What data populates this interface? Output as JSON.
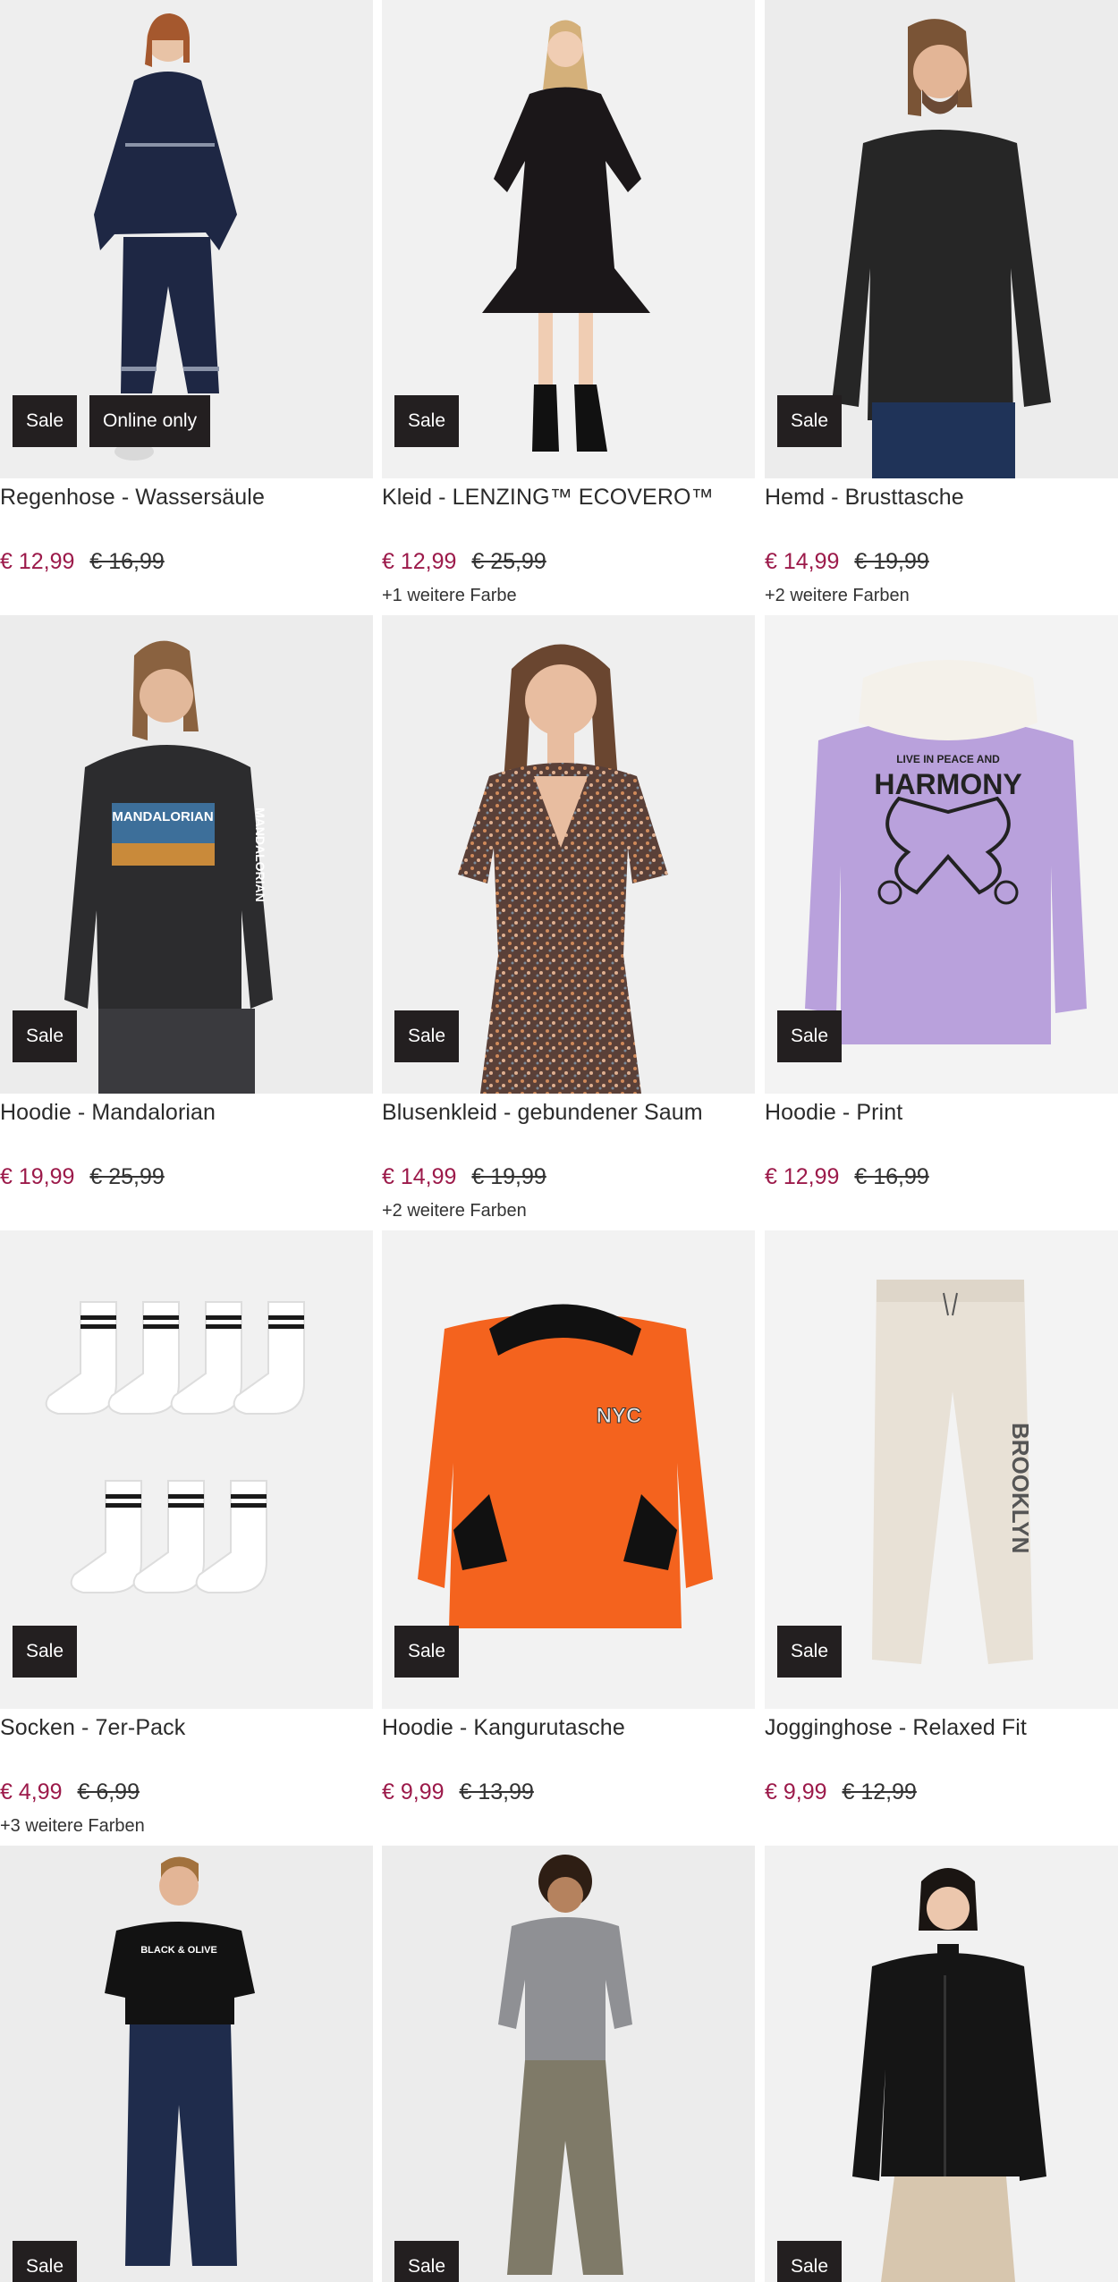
{
  "products": [
    {
      "title": "Regenhose - Wassersäule",
      "price": "€ 12,99",
      "old_price": "€ 16,99",
      "badges": [
        "Sale",
        "Online only"
      ],
      "colors_note": ""
    },
    {
      "title": "Kleid - LENZING™ ECOVERO™",
      "price": "€ 12,99",
      "old_price": "€ 25,99",
      "badges": [
        "Sale"
      ],
      "colors_note": "+1 weitere Farbe"
    },
    {
      "title": "Hemd - Brusttasche",
      "price": "€ 14,99",
      "old_price": "€ 19,99",
      "badges": [
        "Sale"
      ],
      "colors_note": "+2 weitere Farben"
    },
    {
      "title": "Hoodie - Mandalorian",
      "price": "€ 19,99",
      "old_price": "€ 25,99",
      "badges": [
        "Sale"
      ],
      "colors_note": ""
    },
    {
      "title": "Blusenkleid - gebundener Saum",
      "price": "€ 14,99",
      "old_price": "€ 19,99",
      "badges": [
        "Sale"
      ],
      "colors_note": "+2 weitere Farben"
    },
    {
      "title": "Hoodie - Print",
      "price": "€ 12,99",
      "old_price": "€ 16,99",
      "badges": [
        "Sale"
      ],
      "colors_note": ""
    },
    {
      "title": "Socken - 7er-Pack",
      "price": "€ 4,99",
      "old_price": "€ 6,99",
      "badges": [
        "Sale"
      ],
      "colors_note": "+3 weitere Farben"
    },
    {
      "title": "Hoodie - Kangurutasche",
      "price": "€ 9,99",
      "old_price": "€ 13,99",
      "badges": [
        "Sale"
      ],
      "colors_note": ""
    },
    {
      "title": "Jogginghose - Relaxed Fit",
      "price": "€ 9,99",
      "old_price": "€ 12,99",
      "badges": [
        "Sale"
      ],
      "colors_note": ""
    },
    {
      "title": "",
      "price": "",
      "old_price": "",
      "badges": [
        "Sale"
      ],
      "colors_note": ""
    },
    {
      "title": "",
      "price": "",
      "old_price": "",
      "badges": [
        "Sale"
      ],
      "colors_note": ""
    },
    {
      "title": "",
      "price": "",
      "old_price": "",
      "badges": [
        "Sale"
      ],
      "colors_note": ""
    }
  ],
  "print_text": {
    "mandalorian_front": "MANDALORIAN",
    "mandalorian_sleeve": "MANDALORIAN",
    "harmony_small": "LIVE IN PEACE AND",
    "harmony_big": "HARMONY",
    "nyc": "NYC",
    "brooklyn": "BROOKLYN",
    "tshirt_brand": "BLACK & OLIVE"
  },
  "colors": {
    "badge_bg": "#231f20",
    "sale_price": "#9c1a4a",
    "image_bg": "#efefef"
  }
}
